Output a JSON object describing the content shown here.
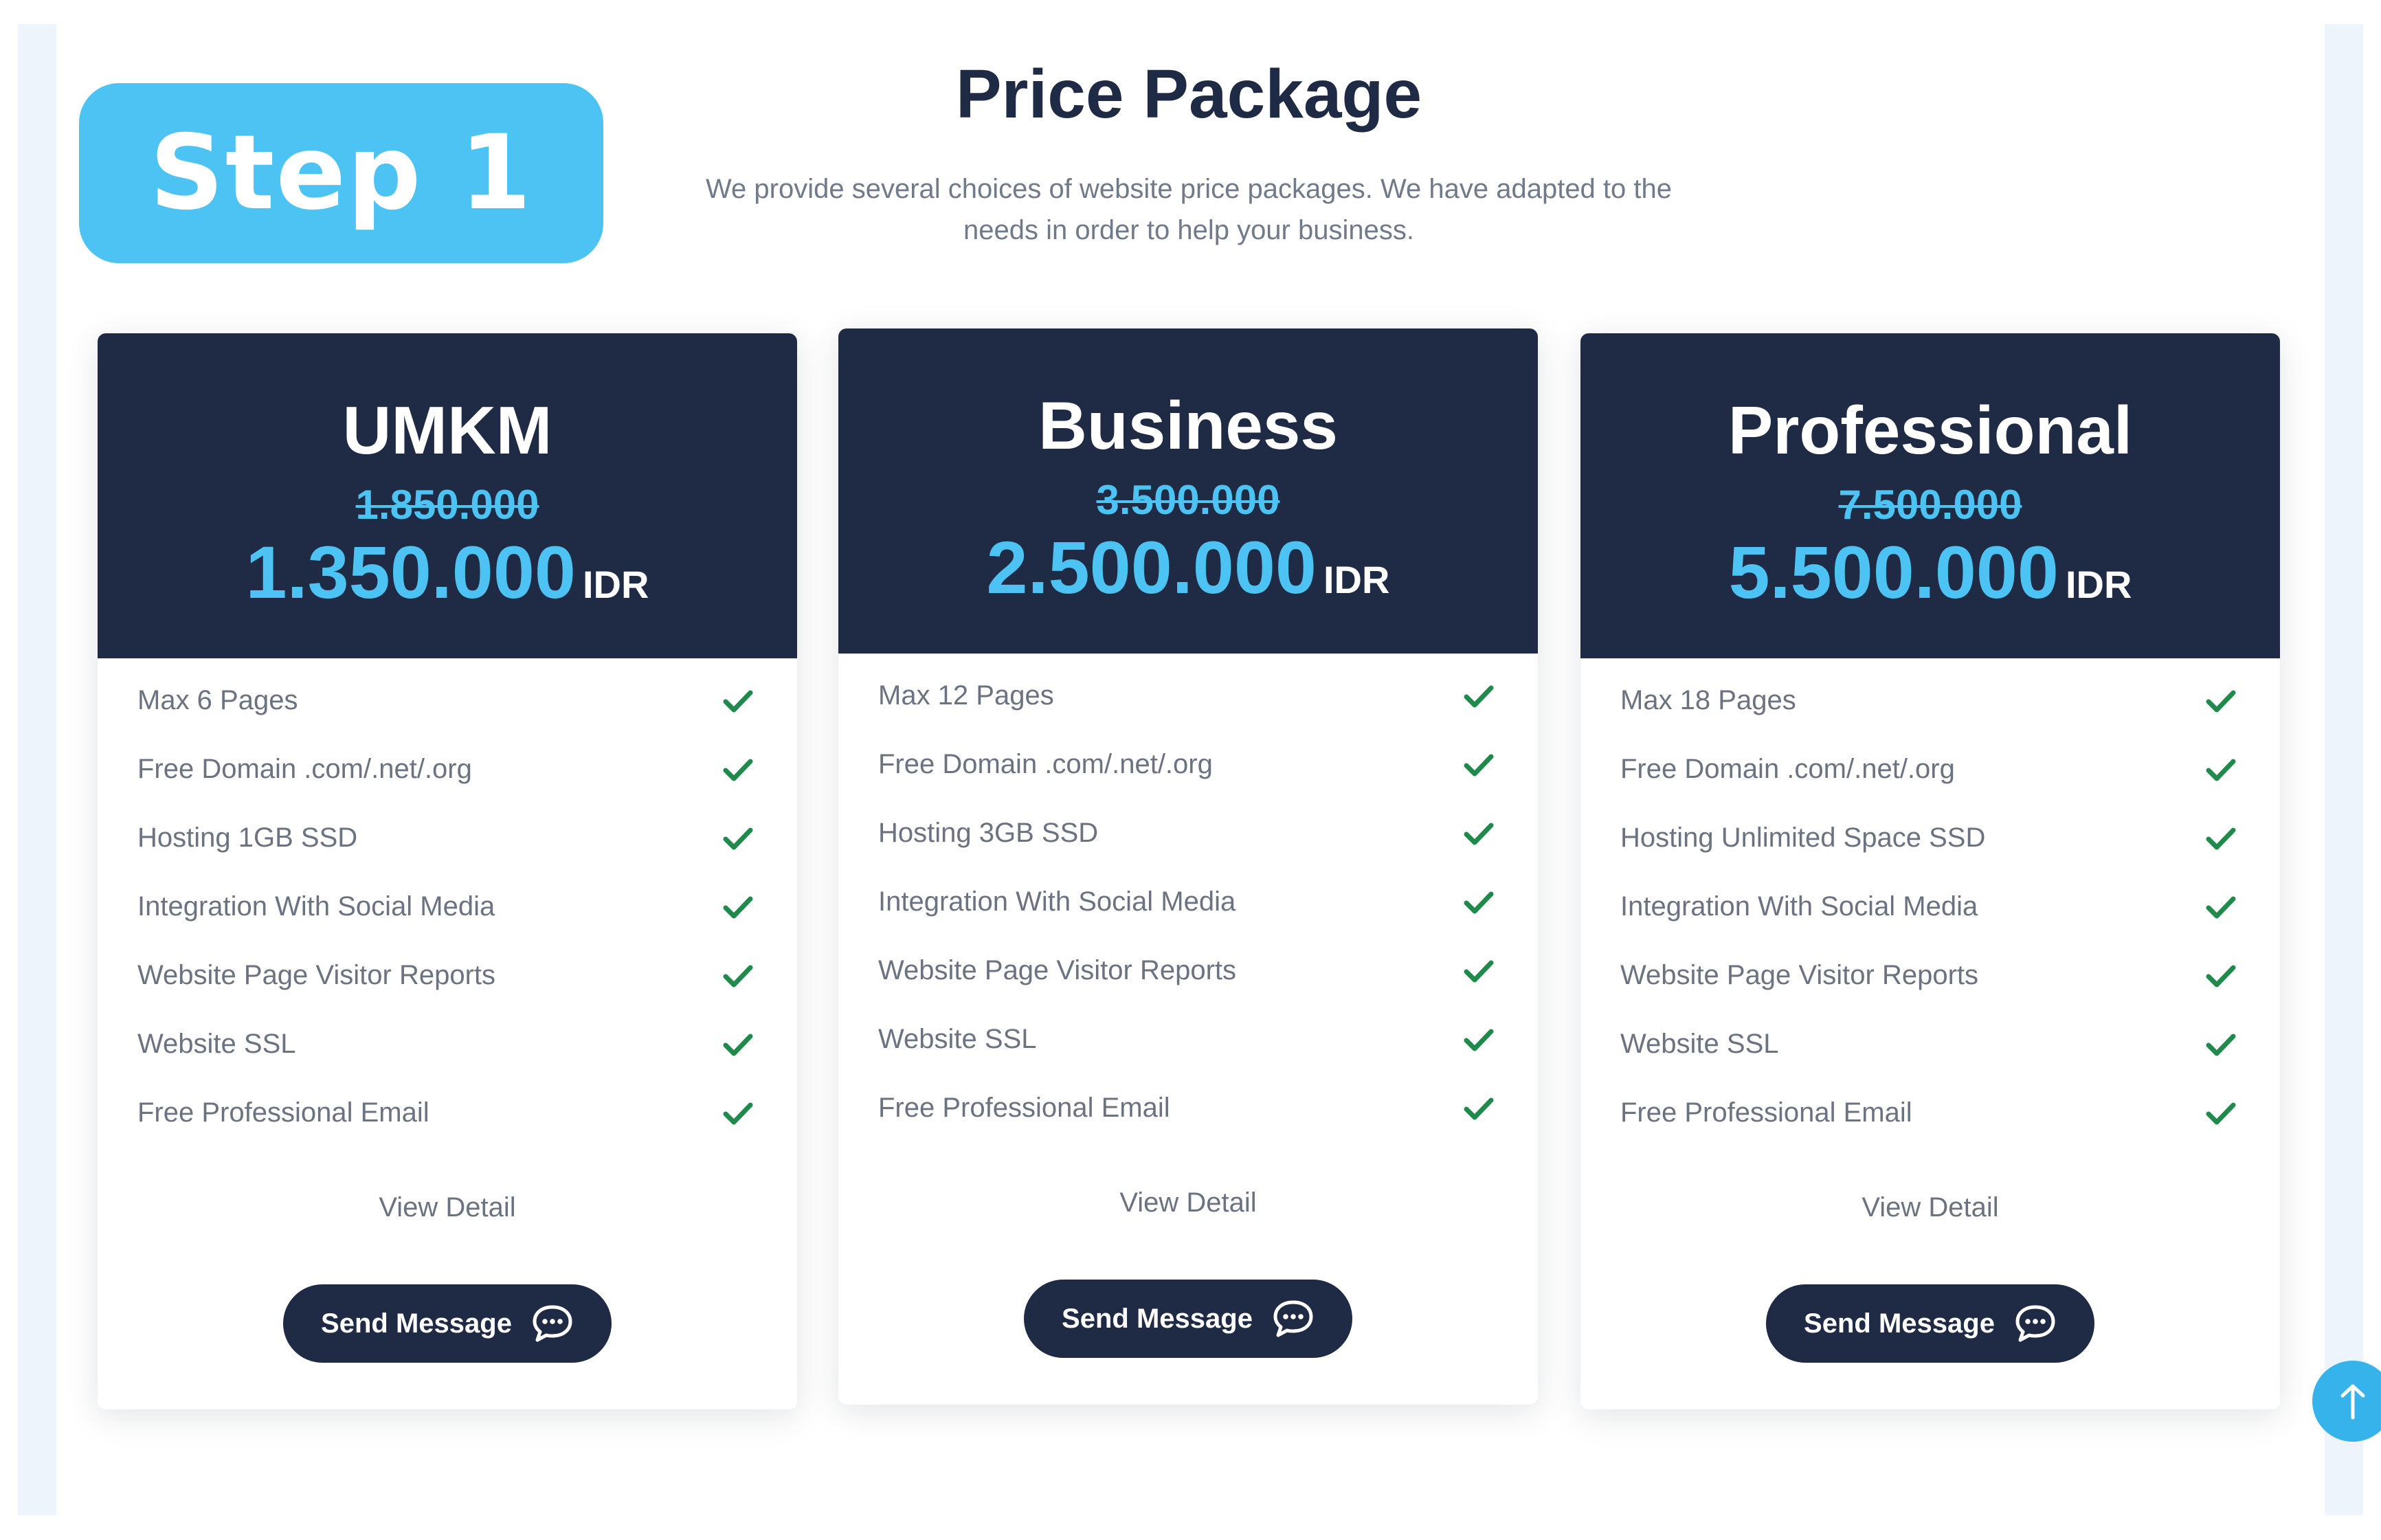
{
  "step_badge": "Step 1",
  "section": {
    "title": "Price Package",
    "subtitle_line1": "We provide several choices of website price packages. We have adapted to the",
    "subtitle_line2": "needs in order to help your business."
  },
  "plans": [
    {
      "name": "UMKM",
      "old_price": "1.850.000",
      "price": "1.350.000",
      "currency": "IDR",
      "features": [
        "Max 6 Pages",
        "Free Domain .com/.net/.org",
        "Hosting 1GB SSD",
        "Integration With Social Media",
        "Website Page Visitor Reports",
        "Website SSL",
        "Free Professional Email"
      ],
      "view_detail": "View Detail",
      "button_label": "Send Message"
    },
    {
      "name": "Business",
      "old_price": "3.500.000",
      "price": "2.500.000",
      "currency": "IDR",
      "features": [
        "Max 12 Pages",
        "Free Domain .com/.net/.org",
        "Hosting 3GB SSD",
        "Integration With Social Media",
        "Website Page Visitor Reports",
        "Website SSL",
        "Free Professional Email"
      ],
      "view_detail": "View Detail",
      "button_label": "Send Message"
    },
    {
      "name": "Professional",
      "old_price": "7.500.000",
      "price": "5.500.000",
      "currency": "IDR",
      "features": [
        "Max 18 Pages",
        "Free Domain .com/.net/.org",
        "Hosting Unlimited Space SSD",
        "Integration With Social Media",
        "Website Page Visitor Reports",
        "Website SSL",
        "Free Professional Email"
      ],
      "view_detail": "View Detail",
      "button_label": "Send Message"
    }
  ],
  "icons": {
    "feature_check": "check-icon",
    "send_button": "chat-bubble-icon",
    "scroll_top": "arrow-up-icon"
  },
  "colors": {
    "header_navy": "#1f2a44",
    "accent_blue": "#4cc3f2",
    "check_green": "#1f8a4c",
    "muted_text": "#6b7280",
    "frame_tint": "#eef4fb"
  }
}
